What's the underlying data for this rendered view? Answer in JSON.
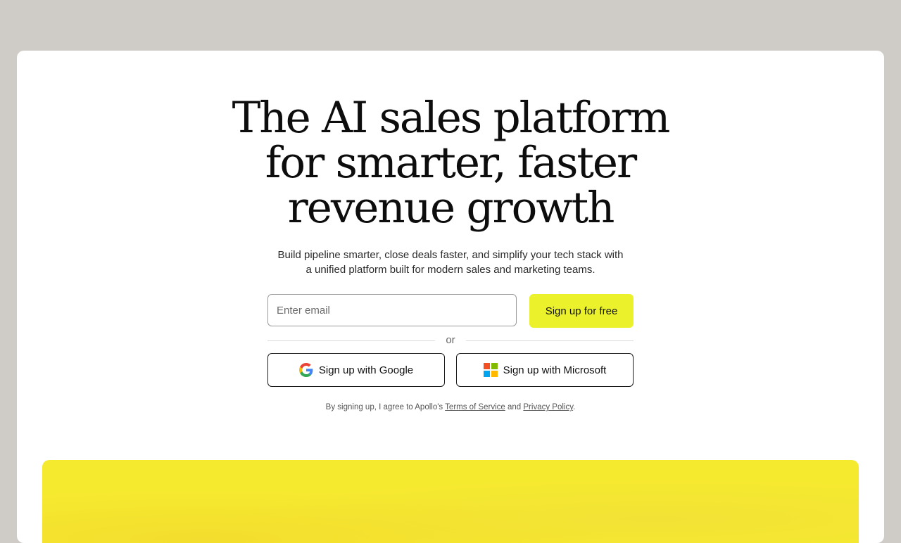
{
  "hero": {
    "headline": [
      "The AI sales platform",
      "for smarter, faster",
      "revenue growth"
    ],
    "subtitle": [
      "Build pipeline smarter, close deals faster, and simplify your tech stack with",
      "a unified platform built for modern sales and marketing teams."
    ]
  },
  "signup": {
    "email_placeholder": "Enter email",
    "submit_label": "Sign up for free",
    "divider_text": "or",
    "google_label": "Sign up with Google",
    "microsoft_label": "Sign up with Microsoft"
  },
  "legal": {
    "prefix": "By signing up, I agree to Apollo's ",
    "terms_link": "Terms of Service",
    "joiner": " and ",
    "privacy_link": "Privacy Policy",
    "suffix": "."
  },
  "colors": {
    "page_bg": "#cfccc8",
    "card_bg": "#ffffff",
    "accent_yellow": "#ebf12a",
    "panel_yellow": "#f6ea2f"
  },
  "icons": {
    "google": "google-logo-icon",
    "microsoft": "microsoft-logo-icon"
  }
}
